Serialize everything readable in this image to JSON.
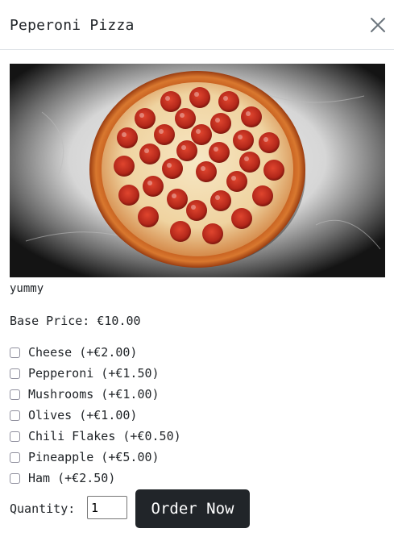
{
  "modal": {
    "title": "Peperoni Pizza",
    "close_icon": "close-icon"
  },
  "product": {
    "image_alt": "pepperoni-pizza-photo",
    "description": "yummy",
    "base_price": "Base Price: €10.00"
  },
  "options": [
    {
      "label": "Cheese (+€2.00)",
      "checked": false
    },
    {
      "label": "Pepperoni (+€1.50)",
      "checked": false
    },
    {
      "label": "Mushrooms (+€1.00)",
      "checked": false
    },
    {
      "label": "Olives (+€1.00)",
      "checked": false
    },
    {
      "label": "Chili Flakes (+€0.50)",
      "checked": false
    },
    {
      "label": "Pineapple (+€5.00)",
      "checked": false
    },
    {
      "label": "Ham (+€2.50)",
      "checked": false
    }
  ],
  "order": {
    "quantity_label": "Quantity:",
    "quantity_value": "1",
    "button_label": "Order Now"
  },
  "colors": {
    "button_bg": "#212529",
    "button_text": "#ffffff",
    "divider": "#dee2e6",
    "text": "#212529"
  }
}
